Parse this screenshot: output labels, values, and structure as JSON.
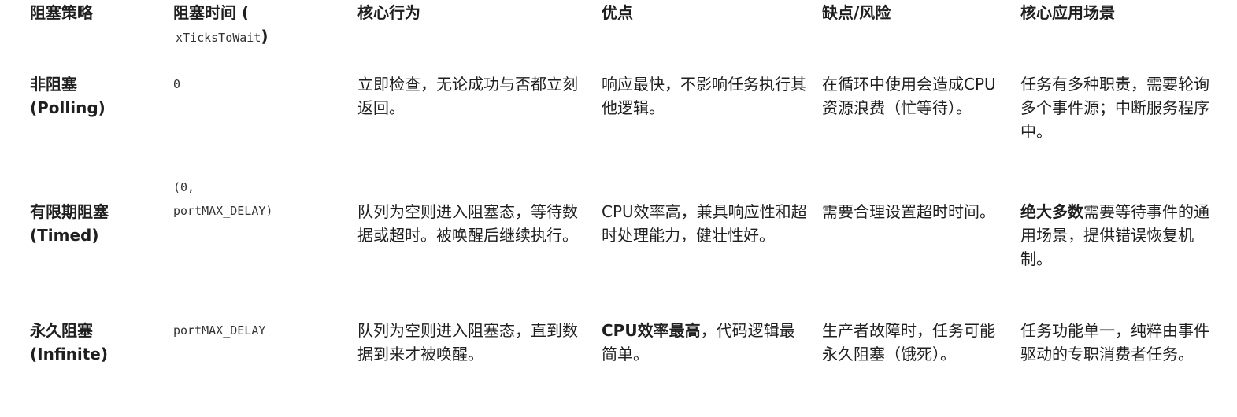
{
  "headers": {
    "strategy": "阻塞策略",
    "time_prefix": "阻塞时间 (",
    "time_param": "xTicksToWait",
    "time_suffix": ")",
    "behavior": "核心行为",
    "pros": "优点",
    "cons": "缺点/风险",
    "scenario": "核心应用场景"
  },
  "rows": [
    {
      "strategy_cn": "非阻塞",
      "strategy_en": "(Polling)",
      "time_line1": "0",
      "time_line2": "",
      "behavior": "立即检查，无论成功与否都立刻返回。",
      "pros_bold": "",
      "pros": "响应最快，不影响任务执行其他逻辑。",
      "cons": "在循环中使用会造成CPU资源浪费（忙等待）。",
      "scenario_bold": "",
      "scenario": "任务有多种职责，需要轮询多个事件源；中断服务程序中。"
    },
    {
      "strategy_cn": "有限期阻塞",
      "strategy_en": "(Timed)",
      "time_line1": "(0,",
      "time_line2": "portMAX_DELAY)",
      "behavior": "队列为空则进入阻塞态，等待数据或超时。被唤醒后继续执行。",
      "pros_bold": "",
      "pros": "CPU效率高，兼具响应性和超时处理能力，健壮性好。",
      "cons": "需要合理设置超时时间。",
      "scenario_bold": "绝大多数",
      "scenario": "需要等待事件的通用场景，提供错误恢复机制。"
    },
    {
      "strategy_cn": "永久阻塞",
      "strategy_en": "(Infinite)",
      "time_line1": "portMAX_DELAY",
      "time_line2": "",
      "behavior": "队列为空则进入阻塞态，直到数据到来才被唤醒。",
      "pros_bold": "CPU效率最高",
      "pros": "，代码逻辑最简单。",
      "cons": "生产者故障时，任务可能永久阻塞（饿死）。",
      "scenario_bold": "",
      "scenario": "任务功能单一，纯粹由事件驱动的专职消费者任务。"
    }
  ]
}
